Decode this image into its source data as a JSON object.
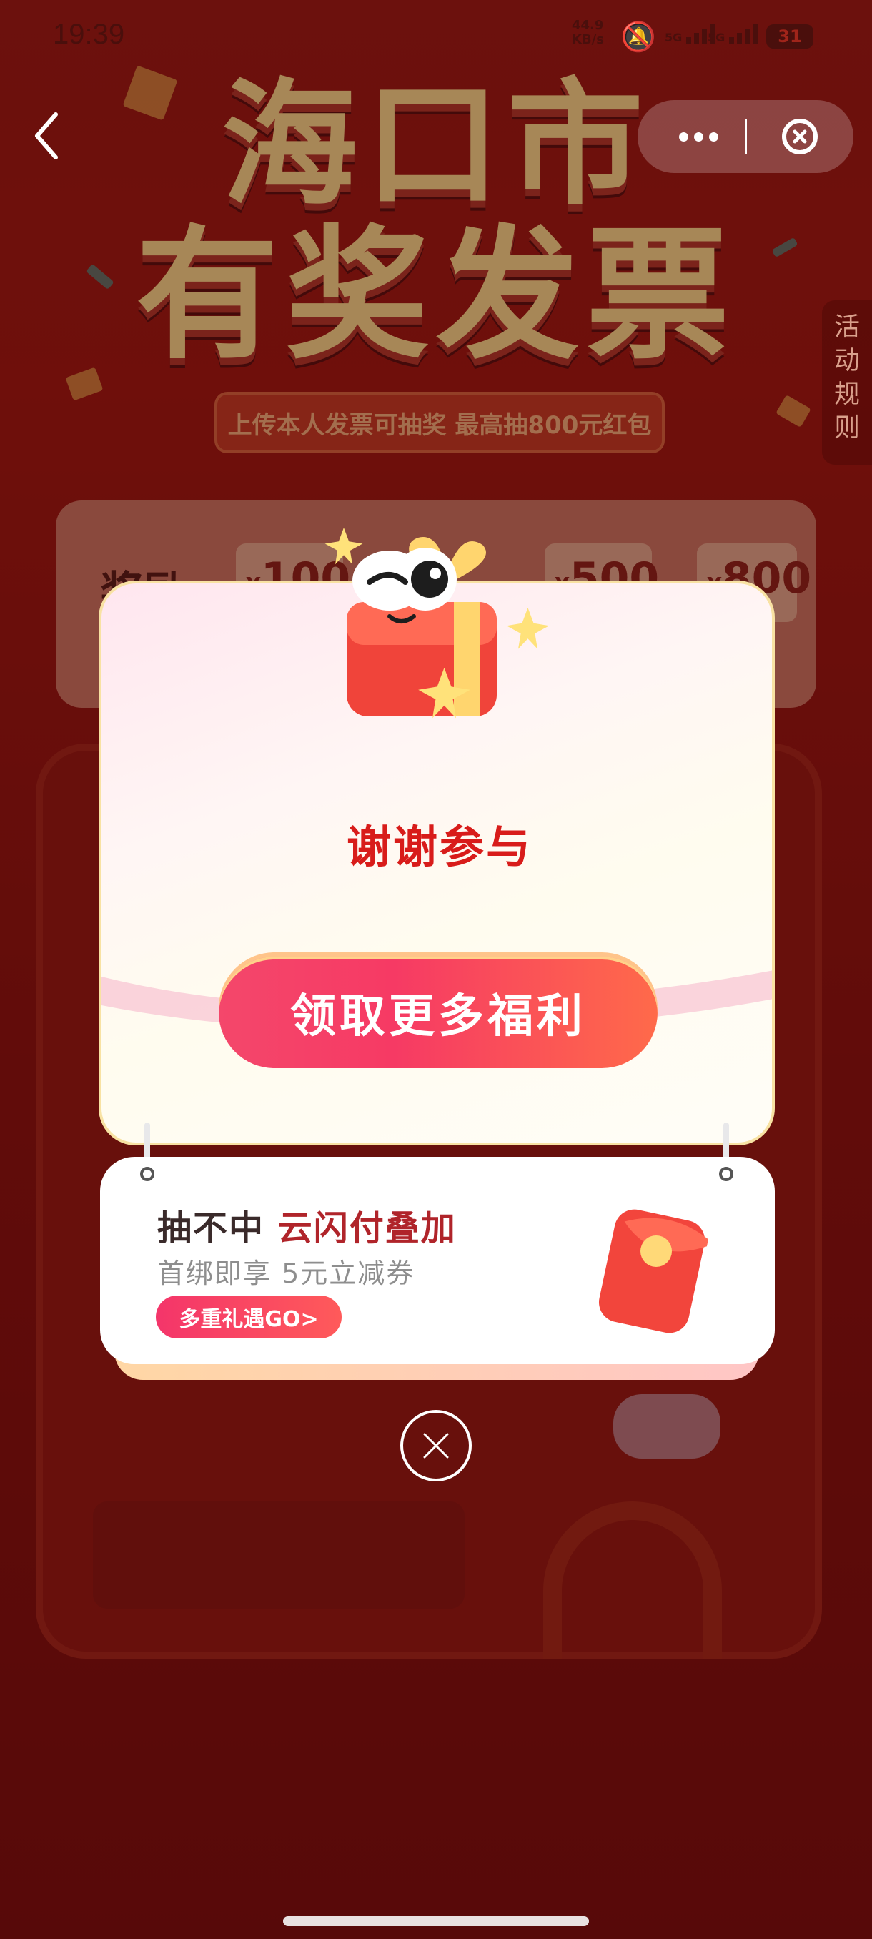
{
  "status_bar": {
    "time": "19:39",
    "net_speed_value": "44.9",
    "net_speed_unit": "KB/s",
    "sig1": "5G",
    "sig2": "5G",
    "battery": "31"
  },
  "header": {
    "title_line1": "海口市",
    "title_line2": "有奖发票",
    "banner_text": "上传本人发票可抽奖 最高抽800元红包"
  },
  "rules_tab": "活动规则",
  "reward": {
    "label": "奖励",
    "prices": [
      "100",
      "500",
      "800"
    ],
    "currency": "¥"
  },
  "modal": {
    "title": "谢谢参与",
    "button_label": "领取更多福利"
  },
  "promo": {
    "title_prefix": "抽不中",
    "title_highlight": "云闪付叠加",
    "description": "首绑即享 5元立减券",
    "button_label": "多重礼遇GO>"
  },
  "colors": {
    "accent_red": "#d81c1a",
    "button_pink": "#f4476b",
    "background_red": "#8e1210"
  },
  "icons": [
    "back-chevron-icon",
    "more-dots-icon",
    "close-circle-icon",
    "gift-mascot-icon",
    "red-envelope-icon",
    "close-icon"
  ]
}
